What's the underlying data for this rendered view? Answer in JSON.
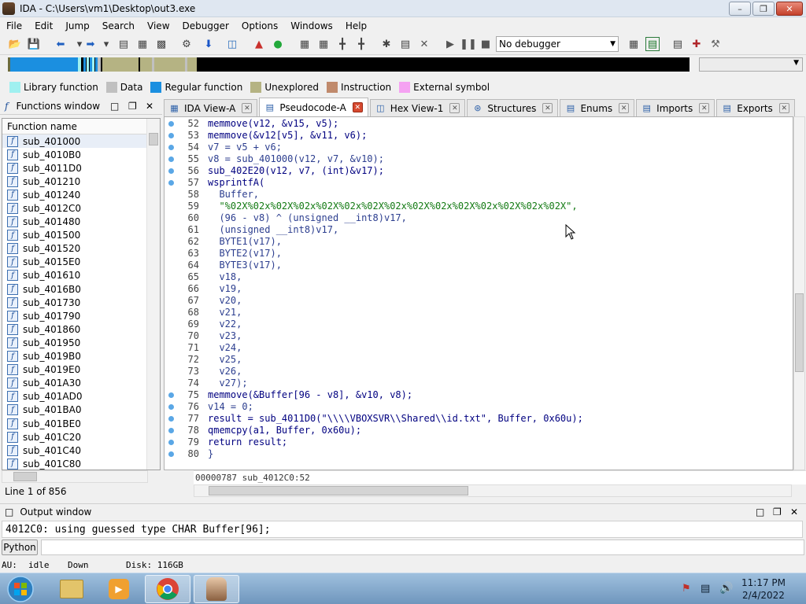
{
  "window": {
    "title": "IDA - C:\\Users\\vm1\\Desktop\\out3.exe"
  },
  "menu": [
    "File",
    "Edit",
    "Jump",
    "Search",
    "View",
    "Debugger",
    "Options",
    "Windows",
    "Help"
  ],
  "toolbar": {
    "debugger_select": "No debugger"
  },
  "legend": [
    {
      "label": "Library function",
      "color": "#9ff0f0"
    },
    {
      "label": "Data",
      "color": "#c0c0c0"
    },
    {
      "label": "Regular function",
      "color": "#1b8fe0"
    },
    {
      "label": "Unexplored",
      "color": "#b5b383"
    },
    {
      "label": "Instruction",
      "color": "#c08a6c"
    },
    {
      "label": "External symbol",
      "color": "#f5a2f2"
    }
  ],
  "functions_window": {
    "title": "Functions window",
    "column_header": "Function name",
    "items": [
      "sub_401000",
      "sub_4010B0",
      "sub_4011D0",
      "sub_401210",
      "sub_401240",
      "sub_4012C0",
      "sub_401480",
      "sub_401500",
      "sub_401520",
      "sub_4015E0",
      "sub_401610",
      "sub_4016B0",
      "sub_401730",
      "sub_401790",
      "sub_401860",
      "sub_401950",
      "sub_4019B0",
      "sub_4019E0",
      "sub_401A30",
      "sub_401AD0",
      "sub_401BA0",
      "sub_401BE0",
      "sub_401C20",
      "sub_401C40",
      "sub_401C80"
    ],
    "status": "Line 1 of 856"
  },
  "tabs": [
    {
      "label": "IDA View-A",
      "active": false
    },
    {
      "label": "Pseudocode-A",
      "active": true
    },
    {
      "label": "Hex View-1",
      "active": false
    },
    {
      "label": "Structures",
      "active": false
    },
    {
      "label": "Enums",
      "active": false
    },
    {
      "label": "Imports",
      "active": false
    },
    {
      "label": "Exports",
      "active": false
    }
  ],
  "code": [
    {
      "n": "52",
      "dot": true,
      "text": "memmove(v12, &v15, v5);"
    },
    {
      "n": "53",
      "dot": true,
      "text": "memmove(&v12[v5], &v11, v6);"
    },
    {
      "n": "54",
      "dot": true,
      "text": "v7 = v5 + v6;"
    },
    {
      "n": "55",
      "dot": true,
      "text": "v8 = sub_401000(v12, v7, &v10);"
    },
    {
      "n": "56",
      "dot": true,
      "text": "sub_402E20(v12, v7, (int)&v17);"
    },
    {
      "n": "57",
      "dot": true,
      "text": "wsprintfA("
    },
    {
      "n": "58",
      "dot": false,
      "text": "  Buffer,"
    },
    {
      "n": "59",
      "dot": false,
      "text": "  \"%02X%02x%02X%02x%02X%02x%02X%02x%02X%02x%02X%02x%02X%02x%02X\","
    },
    {
      "n": "60",
      "dot": false,
      "text": "  (96 - v8) ^ (unsigned __int8)v17,"
    },
    {
      "n": "61",
      "dot": false,
      "text": "  (unsigned __int8)v17,"
    },
    {
      "n": "62",
      "dot": false,
      "text": "  BYTE1(v17),"
    },
    {
      "n": "63",
      "dot": false,
      "text": "  BYTE2(v17),"
    },
    {
      "n": "64",
      "dot": false,
      "text": "  BYTE3(v17),"
    },
    {
      "n": "65",
      "dot": false,
      "text": "  v18,"
    },
    {
      "n": "66",
      "dot": false,
      "text": "  v19,"
    },
    {
      "n": "67",
      "dot": false,
      "text": "  v20,"
    },
    {
      "n": "68",
      "dot": false,
      "text": "  v21,"
    },
    {
      "n": "69",
      "dot": false,
      "text": "  v22,"
    },
    {
      "n": "70",
      "dot": false,
      "text": "  v23,"
    },
    {
      "n": "71",
      "dot": false,
      "text": "  v24,"
    },
    {
      "n": "72",
      "dot": false,
      "text": "  v25,"
    },
    {
      "n": "73",
      "dot": false,
      "text": "  v26,"
    },
    {
      "n": "74",
      "dot": false,
      "text": "  v27);"
    },
    {
      "n": "75",
      "dot": true,
      "text": "memmove(&Buffer[96 - v8], &v10, v8);"
    },
    {
      "n": "76",
      "dot": true,
      "text": "v14 = 0;"
    },
    {
      "n": "77",
      "dot": true,
      "text": "result = sub_4011D0(\"\\\\\\\\VBOXSVR\\\\Shared\\\\id.txt\", Buffer, 0x60u);"
    },
    {
      "n": "78",
      "dot": true,
      "text": "qmemcpy(a1, Buffer, 0x60u);"
    },
    {
      "n": "79",
      "dot": true,
      "text": "return result;"
    },
    {
      "n": "80",
      "dot": true,
      "text": "}"
    }
  ],
  "code_status": "00000787 sub_4012C0:52",
  "output": {
    "title": "Output window",
    "text": "4012C0: using guessed type CHAR Buffer[96];",
    "python_label": "Python"
  },
  "statusbar": {
    "au": "AU:",
    "state": "idle",
    "direction": "Down",
    "disk": "Disk: 116GB"
  },
  "taskbar": {
    "time": "11:17 PM",
    "date": "2/4/2022"
  }
}
